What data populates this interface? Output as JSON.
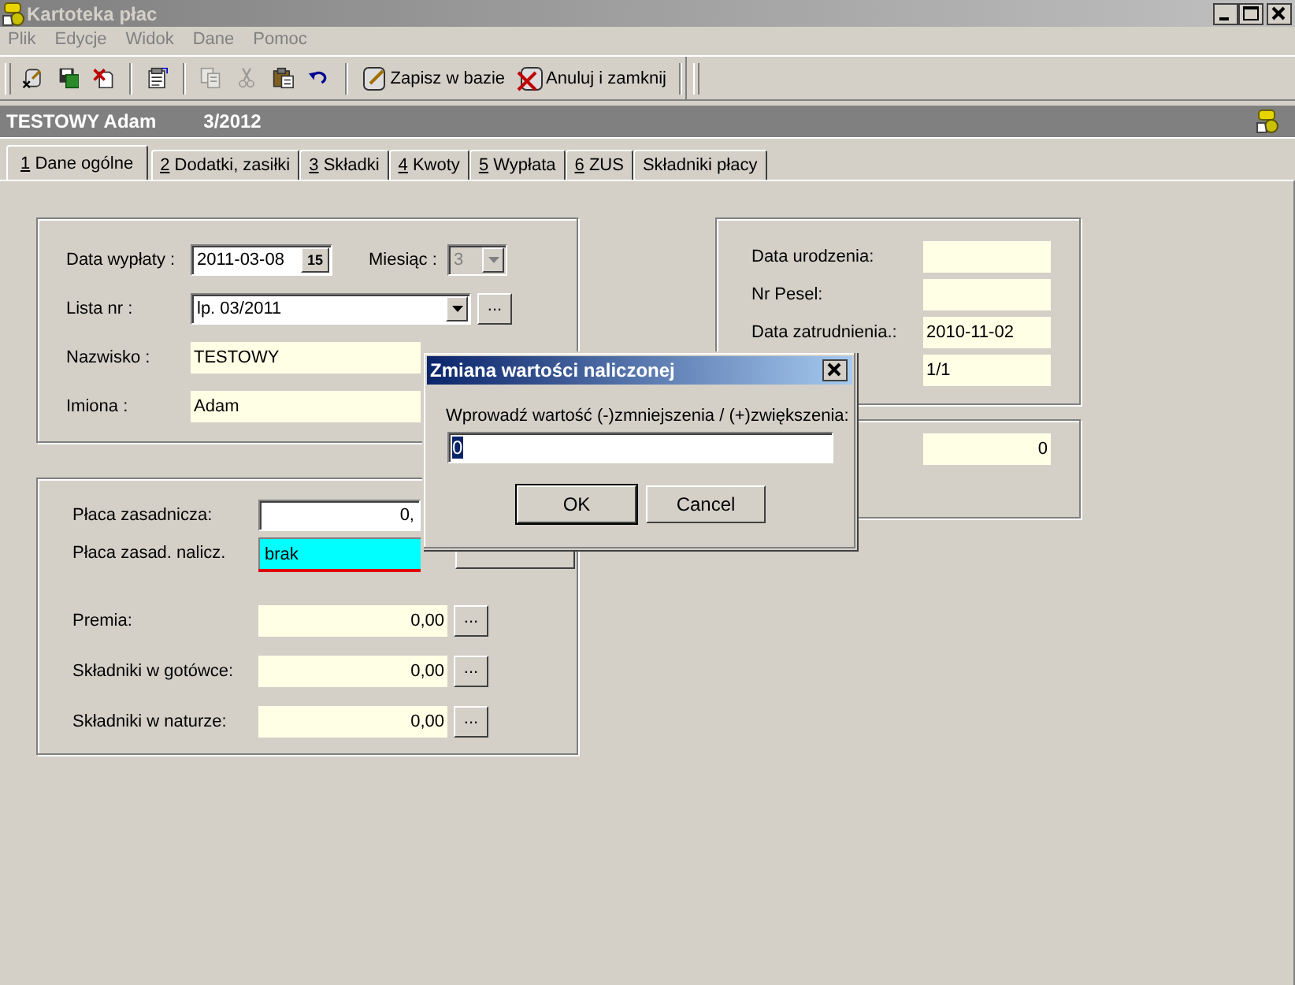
{
  "window": {
    "title": "Kartoteka płac"
  },
  "menu": [
    {
      "label": "Plik",
      "disabled": true
    },
    {
      "label": "Edycje",
      "disabled": true
    },
    {
      "label": "Widok",
      "disabled": true
    },
    {
      "label": "Dane",
      "disabled": true
    },
    {
      "label": "Pomoc",
      "disabled": true
    }
  ],
  "toolbar": {
    "groups": [
      [
        {
          "kind": "icon",
          "disabled": false
        },
        {
          "kind": "icon",
          "disabled": false
        },
        {
          "kind": "icon",
          "disabled": false
        }
      ],
      [
        {
          "kind": "icon",
          "disabled": false
        }
      ],
      [
        {
          "kind": "icon",
          "disabled": true
        },
        {
          "kind": "icon",
          "disabled": true
        },
        {
          "kind": "icon",
          "disabled": false
        },
        {
          "kind": "icon",
          "disabled": false
        }
      ],
      [
        {
          "kind": "text",
          "label": "Zapisz w bazie"
        },
        {
          "kind": "text",
          "label": "Anuluj i zamknij"
        }
      ]
    ]
  },
  "header": {
    "employee": "TESTOWY Adam",
    "period": "3/2012"
  },
  "tabs": [
    {
      "key": "1",
      "label": "Dane ogólne",
      "selected": true
    },
    {
      "key": "2",
      "label": "Dodatki, zasiłki",
      "selected": false
    },
    {
      "key": "3",
      "label": "Składki",
      "selected": false
    },
    {
      "key": "4",
      "label": "Kwoty",
      "selected": false
    },
    {
      "key": "5",
      "label": "Wypłata",
      "selected": false
    },
    {
      "key": "6",
      "label": "ZUS",
      "selected": false
    },
    {
      "label": "Składniki płacy",
      "selected": false
    }
  ],
  "columns": [
    [
      {
        "rows": [
          {
            "label": "Data wypłaty :",
            "kind": "date",
            "value": "2011-03-08",
            "button": "15",
            "extra": {
              "label": "Miesiąc :",
              "kind": "combo",
              "value": "3",
              "disabled": true
            }
          },
          {
            "label": "Lista nr :",
            "kind": "combo",
            "value": "lp. 03/2011",
            "disabled": false,
            "more": "..."
          },
          {
            "label": "Nazwisko :",
            "kind": "readonly",
            "value": "TESTOWY"
          },
          {
            "label": "Imiona :",
            "kind": "readonly",
            "value": "Adam"
          }
        ]
      },
      {
        "rows": [
          {
            "label": "Płaca zasadnicza:",
            "kind": "edit",
            "value": "0,"
          },
          {
            "label": "Płaca zasad. nalicz.",
            "kind": "marked",
            "value": "brak",
            "side_button": true
          },
          {
            "label": "Premia:",
            "kind": "amount",
            "value": "0,00",
            "more": "..."
          },
          {
            "label": "Składniki w gotówce:",
            "kind": "amount",
            "value": "0,00",
            "more": "..."
          },
          {
            "label": "Składniki w naturze:",
            "kind": "amount",
            "value": "0,00",
            "more": "..."
          }
        ]
      }
    ],
    [
      {
        "rows": [
          {
            "label": "Data urodzenia:",
            "kind": "readonly"
          },
          {
            "label": "Nr Pesel:",
            "kind": "readonly"
          },
          {
            "label": "Data zatrudnienia.:",
            "kind": "readonly",
            "value": "2010-11-02"
          },
          {
            "kind": "readonly",
            "value": "1/1"
          }
        ]
      },
      {
        "rows": [
          {
            "kind": "amount",
            "value": "0"
          }
        ]
      }
    ]
  ],
  "dialog": {
    "title": "Zmiana wartości naliczonej",
    "prompt": "Wprowadź wartość (-)zmniejszenia / (+)zwiększenia:",
    "value": "0",
    "value_selected": true,
    "buttons": [
      {
        "label": "OK",
        "default": true
      },
      {
        "label": "Cancel",
        "default": false
      }
    ]
  }
}
